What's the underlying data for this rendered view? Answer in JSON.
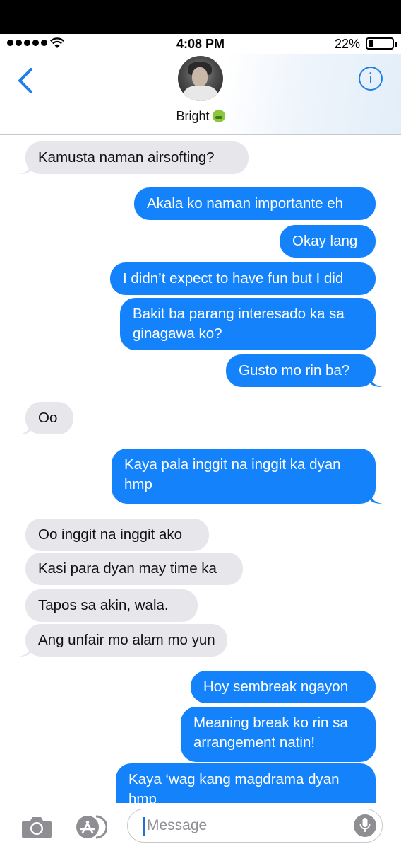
{
  "status_bar": {
    "time": "4:08 PM",
    "battery_pct": "22%",
    "battery_level": 0.22
  },
  "header": {
    "contact_name": "Bright",
    "contact_emoji": "nauseated-face-emoji",
    "back_icon": "chevron-left-icon",
    "info_icon": "info-icon"
  },
  "messages": [
    {
      "dir": "in",
      "text": "Kamusta naman airsofting?"
    },
    {
      "dir": "out",
      "text": "Akala ko naman importante eh"
    },
    {
      "dir": "out",
      "text": "Okay lang"
    },
    {
      "dir": "out",
      "text": "I didn’t expect to have fun but I did"
    },
    {
      "dir": "out",
      "text": "Bakit ba parang interesado ka sa ginagawa ko?"
    },
    {
      "dir": "out",
      "text": "Gusto mo rin ba?"
    },
    {
      "dir": "in",
      "text": "Oo"
    },
    {
      "dir": "out",
      "text": "Kaya pala inggit na inggit ka dyan hmp"
    },
    {
      "dir": "in",
      "text": "Oo inggit na inggit ako"
    },
    {
      "dir": "in",
      "text": "Kasi para dyan may time ka"
    },
    {
      "dir": "in",
      "text": "Tapos sa akin, wala."
    },
    {
      "dir": "in",
      "text": "Ang unfair mo alam mo yun"
    },
    {
      "dir": "out",
      "text": "Hoy sembreak ngayon"
    },
    {
      "dir": "out",
      "text": "Meaning break ko rin sa arrangement natin!"
    },
    {
      "dir": "out",
      "text": "Kaya ‘wag kang magdrama dyan hmp"
    }
  ],
  "composer": {
    "placeholder": "Message",
    "camera_icon": "camera-icon",
    "apps_icon": "app-store-icon",
    "mic_icon": "microphone-icon"
  },
  "colors": {
    "accent": "#1f80ea",
    "outgoing_bubble": "#1483fb",
    "incoming_bubble": "#e6e6eb"
  }
}
